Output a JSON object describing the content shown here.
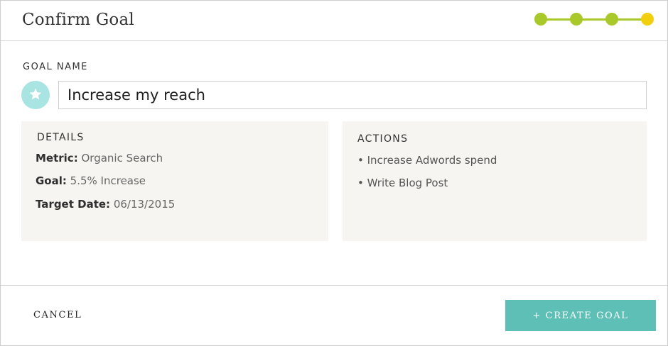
{
  "header": {
    "title": "Confirm Goal",
    "progress": {
      "steps_total": 4,
      "completed_steps": 3,
      "current_step": 4
    }
  },
  "goal": {
    "section_label": "GOAL NAME",
    "icon": "star-icon",
    "name_value": "Increase my reach"
  },
  "details": {
    "heading": "DETAILS",
    "rows": [
      {
        "key": "Metric:",
        "value": "Organic Search"
      },
      {
        "key": "Goal:",
        "value": "5.5% Increase"
      },
      {
        "key": "Target Date:",
        "value": "06/13/2015"
      }
    ]
  },
  "actions": {
    "heading": "ACTIONS",
    "items": [
      "• Increase Adwords spend",
      "• Write Blog Post"
    ]
  },
  "footer": {
    "cancel_label": "CANCEL",
    "create_label": "+ CREATE GOAL"
  },
  "colors": {
    "progress_done": "#a9c92a",
    "progress_current": "#f2cf0d",
    "star_badge": "#a8e4e2",
    "primary_button": "#5ebfb6",
    "panel_background": "#f6f5f2"
  }
}
